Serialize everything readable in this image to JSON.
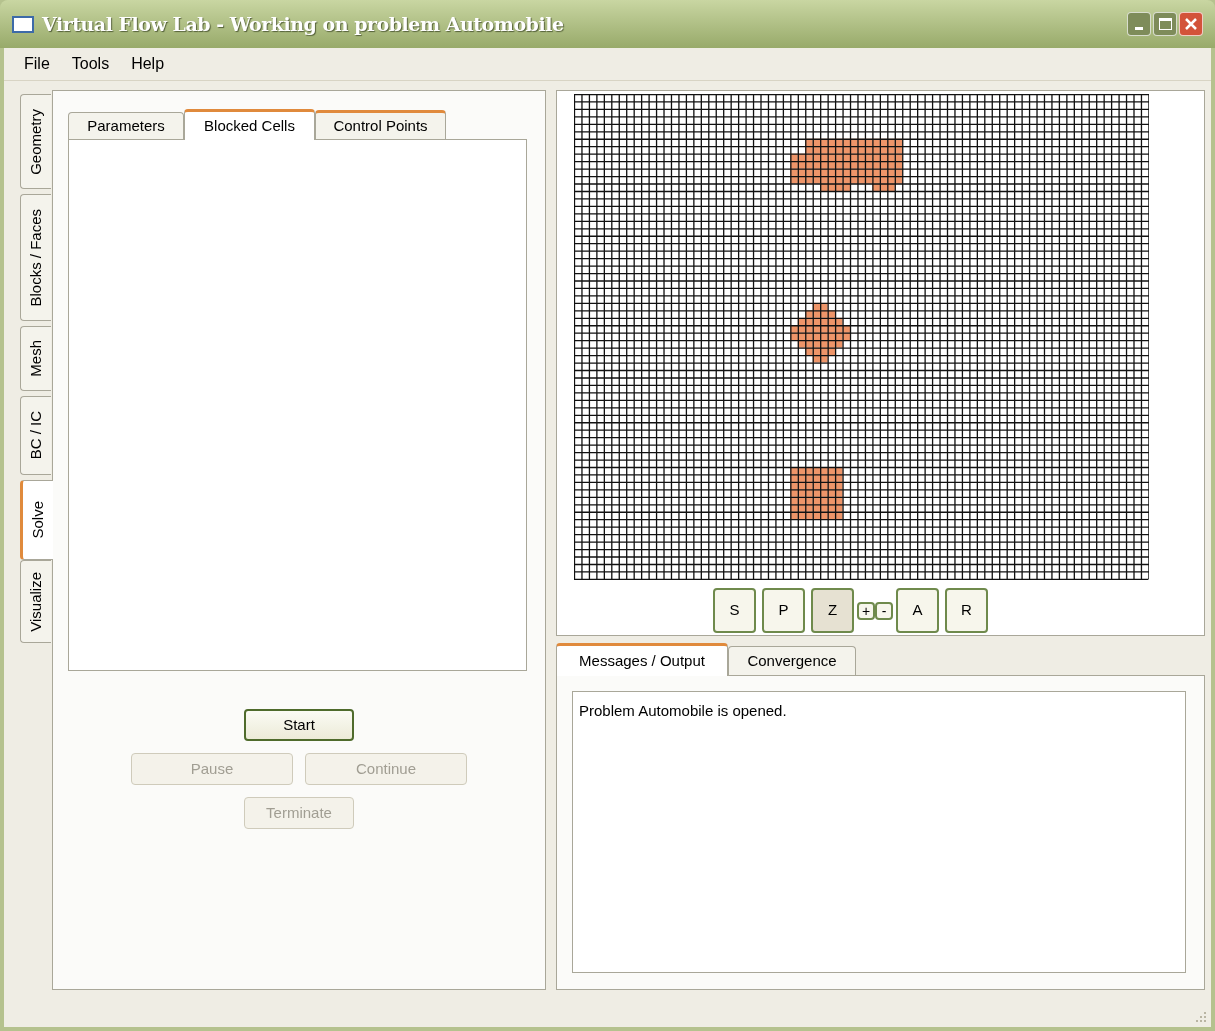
{
  "window": {
    "title": "Virtual Flow Lab - Working on problem Automobile"
  },
  "menu": [
    "File",
    "Tools",
    "Help"
  ],
  "side_tabs": [
    {
      "label": "Geometry",
      "selected": false
    },
    {
      "label": "Blocks / Faces",
      "selected": false
    },
    {
      "label": "Mesh",
      "selected": false
    },
    {
      "label": "BC / IC",
      "selected": false
    },
    {
      "label": "Solve",
      "selected": true
    },
    {
      "label": "Visualize",
      "selected": false
    }
  ],
  "sub_tabs": [
    {
      "label": "Parameters",
      "selected": false,
      "hot": false
    },
    {
      "label": "Blocked Cells",
      "selected": true,
      "hot": false
    },
    {
      "label": "Control Points",
      "selected": false,
      "hot": true
    }
  ],
  "solve_buttons": [
    [
      {
        "label": "Start",
        "disabled": false
      }
    ],
    [
      {
        "label": "Pause",
        "disabled": true
      },
      {
        "label": "Continue",
        "disabled": true
      }
    ],
    [
      {
        "label": "Terminate",
        "disabled": true
      }
    ]
  ],
  "view_buttons": [
    {
      "label": "S",
      "kind": "large",
      "pressed": false
    },
    {
      "label": "P",
      "kind": "large",
      "pressed": false
    },
    {
      "label": "Z",
      "kind": "large",
      "pressed": true
    },
    {
      "label": "+",
      "kind": "small",
      "pressed": false
    },
    {
      "label": "-",
      "kind": "small",
      "pressed": false
    },
    {
      "label": "A",
      "kind": "large",
      "pressed": false
    },
    {
      "label": "R",
      "kind": "large",
      "pressed": false
    }
  ],
  "output_tabs": [
    {
      "label": "Messages / Output",
      "selected": true
    },
    {
      "label": "Convergence",
      "selected": false
    }
  ],
  "messages": [
    "Problem Automobile is opened."
  ]
}
